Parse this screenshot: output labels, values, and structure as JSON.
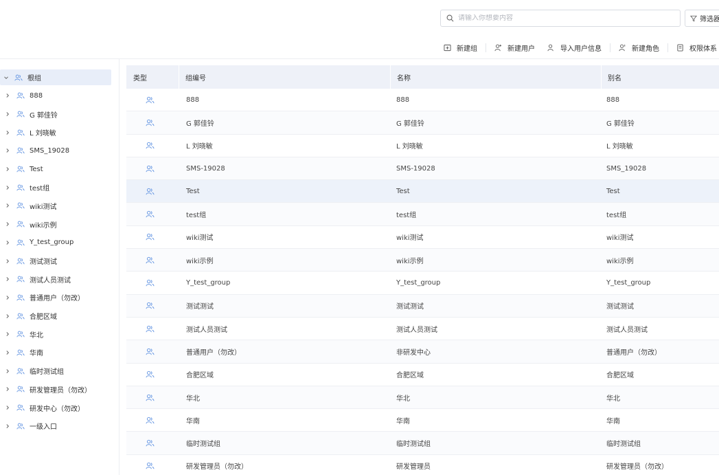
{
  "search": {
    "placeholder": "请输入你想要内容",
    "value": ""
  },
  "filter_label": "筛选器",
  "toolbar": [
    {
      "label": "新建组",
      "icon": "add-folder-icon"
    },
    {
      "label": "新建用户",
      "icon": "add-user-icon"
    },
    {
      "label": "导入用户信息",
      "icon": "import-user-icon"
    },
    {
      "label": "新建角色",
      "icon": "add-role-icon"
    },
    {
      "label": "权限体系",
      "icon": "document-icon"
    }
  ],
  "tree": {
    "root": "根组",
    "items": [
      "888",
      "G 郭佳铃",
      "L 刘晓敏",
      "SMS_19028",
      "Test",
      "test组",
      "wiki测试",
      "wiki示例",
      "Y_test_group",
      "测试测试",
      "测试人员测试",
      "普通用户（勿改）",
      "合肥区域",
      "华北",
      "华南",
      "临时测试组",
      "研发管理员（勿改）",
      "研发中心（勿改）",
      "一级入口"
    ]
  },
  "table": {
    "headers": [
      "类型",
      "组编号",
      "名称",
      "别名"
    ],
    "rows": [
      [
        "888",
        "888",
        "888"
      ],
      [
        "G 郭佳铃",
        "G 郭佳铃",
        "G 郭佳铃"
      ],
      [
        "L 刘晓敏",
        "L 刘晓敏",
        "L 刘晓敏"
      ],
      [
        "SMS-19028",
        "SMS-19028",
        "SMS_19028"
      ],
      [
        "Test",
        "Test",
        "Test"
      ],
      [
        "test组",
        "test组",
        "test组"
      ],
      [
        "wiki测试",
        "wiki测试",
        "wiki测试"
      ],
      [
        "wiki示例",
        "wiki示例",
        "wiki示例"
      ],
      [
        "Y_test_group",
        "Y_test_group",
        "Y_test_group"
      ],
      [
        "测试测试",
        "测试测试",
        "测试测试"
      ],
      [
        "测试人员测试",
        "测试人员测试",
        "测试人员测试"
      ],
      [
        "普通用户（勿改）",
        "非研发中心",
        "普通用户（勿改）"
      ],
      [
        "合肥区域",
        "合肥区域",
        "合肥区域"
      ],
      [
        "华北",
        "华北",
        "华北"
      ],
      [
        "华南",
        "华南",
        "华南"
      ],
      [
        "临时测试组",
        "临时测试组",
        "临时测试组"
      ],
      [
        "研发管理员（勿改）",
        "研发管理员",
        "研发管理员（勿改）"
      ]
    ],
    "highlighted_row": 4
  },
  "colors": {
    "accent": "#3a6fd8",
    "icon": "#5b8fe0",
    "header_bg": "#eef1f8",
    "selected_bg": "#e8eef9"
  }
}
